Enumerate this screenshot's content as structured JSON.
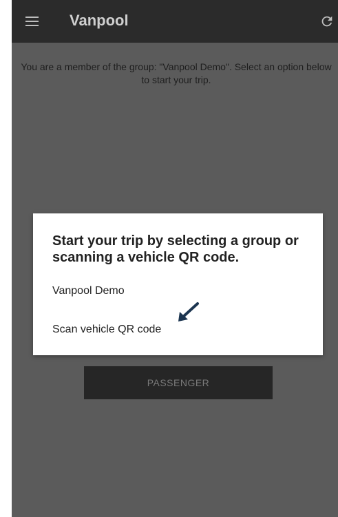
{
  "appbar": {
    "title": "Vanpool",
    "menu_icon": "hamburger-menu-icon",
    "refresh_icon": "refresh-icon"
  },
  "main": {
    "intro_text": "You are a member of the group: \"Vanpool Demo\". Select an option below to start your trip.",
    "passenger_label": "PASSENGER"
  },
  "dialog": {
    "title": "Start your trip by selecting a group or scanning a vehicle QR code.",
    "options": [
      {
        "label": "Vanpool Demo"
      },
      {
        "label": "Scan vehicle QR code"
      }
    ]
  },
  "annotation": {
    "icon": "pointer-arrow-icon"
  },
  "colors": {
    "appbar": "#2b2b2b",
    "overlay": "#5b5b5b",
    "dialog": "#ffffff",
    "arrow": "#1c3550"
  }
}
